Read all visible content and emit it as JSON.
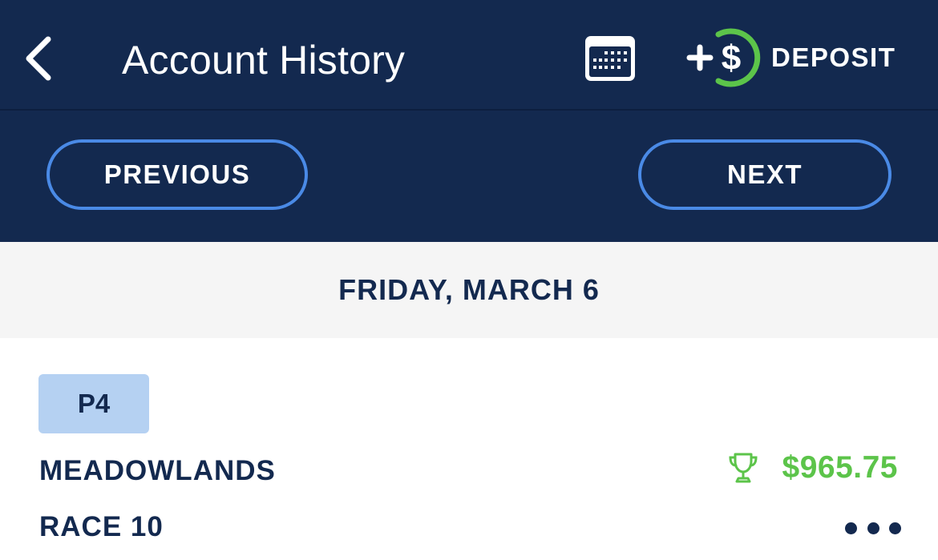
{
  "navbar": {
    "title": "Account History",
    "back_icon": "chevron-left-icon",
    "calendar_icon": "calendar-icon",
    "deposit_icon": "plus-dollar-circle-icon",
    "deposit_label": "DEPOSIT"
  },
  "pager": {
    "previous_label": "PREVIOUS",
    "next_label": "NEXT"
  },
  "date_header": "FRIDAY, MARCH 6",
  "wager": {
    "bet_type": "P4",
    "track": "MEADOWLANDS",
    "race": "RACE 10",
    "payout": "$965.75",
    "payout_icon": "trophy-icon",
    "more_icon": "more-dots-icon"
  },
  "colors": {
    "navy": "#13294f",
    "accent_blue": "#4a8ae6",
    "badge_blue": "#b5d1f2",
    "win_green": "#5cc44a",
    "header_gray": "#f5f5f5"
  }
}
